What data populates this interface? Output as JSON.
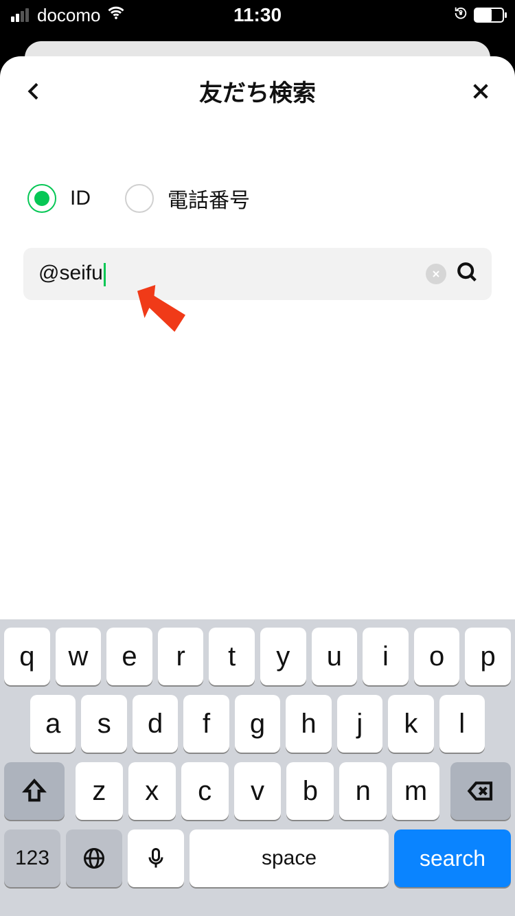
{
  "statusbar": {
    "carrier": "docomo",
    "time": "11:30"
  },
  "header": {
    "title": "友だち検索"
  },
  "search_type": {
    "id_label": "ID",
    "phone_label": "電話番号",
    "selected": "id"
  },
  "search": {
    "value": "@seifu"
  },
  "keyboard": {
    "row1": [
      "q",
      "w",
      "e",
      "r",
      "t",
      "y",
      "u",
      "i",
      "o",
      "p"
    ],
    "row2": [
      "a",
      "s",
      "d",
      "f",
      "g",
      "h",
      "j",
      "k",
      "l"
    ],
    "row3": [
      "z",
      "x",
      "c",
      "v",
      "b",
      "n",
      "m"
    ],
    "fn_label": "123",
    "space_label": "space",
    "search_label": "search"
  }
}
